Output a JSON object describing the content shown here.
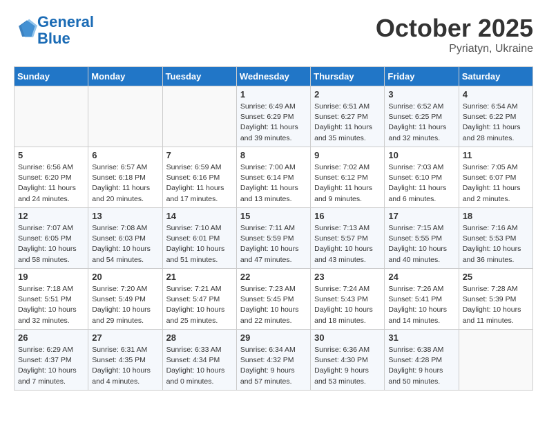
{
  "header": {
    "logo_line1": "General",
    "logo_line2": "Blue",
    "month": "October 2025",
    "location": "Pyriatyn, Ukraine"
  },
  "weekdays": [
    "Sunday",
    "Monday",
    "Tuesday",
    "Wednesday",
    "Thursday",
    "Friday",
    "Saturday"
  ],
  "weeks": [
    [
      {
        "day": "",
        "info": ""
      },
      {
        "day": "",
        "info": ""
      },
      {
        "day": "",
        "info": ""
      },
      {
        "day": "1",
        "info": "Sunrise: 6:49 AM\nSunset: 6:29 PM\nDaylight: 11 hours\nand 39 minutes."
      },
      {
        "day": "2",
        "info": "Sunrise: 6:51 AM\nSunset: 6:27 PM\nDaylight: 11 hours\nand 35 minutes."
      },
      {
        "day": "3",
        "info": "Sunrise: 6:52 AM\nSunset: 6:25 PM\nDaylight: 11 hours\nand 32 minutes."
      },
      {
        "day": "4",
        "info": "Sunrise: 6:54 AM\nSunset: 6:22 PM\nDaylight: 11 hours\nand 28 minutes."
      }
    ],
    [
      {
        "day": "5",
        "info": "Sunrise: 6:56 AM\nSunset: 6:20 PM\nDaylight: 11 hours\nand 24 minutes."
      },
      {
        "day": "6",
        "info": "Sunrise: 6:57 AM\nSunset: 6:18 PM\nDaylight: 11 hours\nand 20 minutes."
      },
      {
        "day": "7",
        "info": "Sunrise: 6:59 AM\nSunset: 6:16 PM\nDaylight: 11 hours\nand 17 minutes."
      },
      {
        "day": "8",
        "info": "Sunrise: 7:00 AM\nSunset: 6:14 PM\nDaylight: 11 hours\nand 13 minutes."
      },
      {
        "day": "9",
        "info": "Sunrise: 7:02 AM\nSunset: 6:12 PM\nDaylight: 11 hours\nand 9 minutes."
      },
      {
        "day": "10",
        "info": "Sunrise: 7:03 AM\nSunset: 6:10 PM\nDaylight: 11 hours\nand 6 minutes."
      },
      {
        "day": "11",
        "info": "Sunrise: 7:05 AM\nSunset: 6:07 PM\nDaylight: 11 hours\nand 2 minutes."
      }
    ],
    [
      {
        "day": "12",
        "info": "Sunrise: 7:07 AM\nSunset: 6:05 PM\nDaylight: 10 hours\nand 58 minutes."
      },
      {
        "day": "13",
        "info": "Sunrise: 7:08 AM\nSunset: 6:03 PM\nDaylight: 10 hours\nand 54 minutes."
      },
      {
        "day": "14",
        "info": "Sunrise: 7:10 AM\nSunset: 6:01 PM\nDaylight: 10 hours\nand 51 minutes."
      },
      {
        "day": "15",
        "info": "Sunrise: 7:11 AM\nSunset: 5:59 PM\nDaylight: 10 hours\nand 47 minutes."
      },
      {
        "day": "16",
        "info": "Sunrise: 7:13 AM\nSunset: 5:57 PM\nDaylight: 10 hours\nand 43 minutes."
      },
      {
        "day": "17",
        "info": "Sunrise: 7:15 AM\nSunset: 5:55 PM\nDaylight: 10 hours\nand 40 minutes."
      },
      {
        "day": "18",
        "info": "Sunrise: 7:16 AM\nSunset: 5:53 PM\nDaylight: 10 hours\nand 36 minutes."
      }
    ],
    [
      {
        "day": "19",
        "info": "Sunrise: 7:18 AM\nSunset: 5:51 PM\nDaylight: 10 hours\nand 32 minutes."
      },
      {
        "day": "20",
        "info": "Sunrise: 7:20 AM\nSunset: 5:49 PM\nDaylight: 10 hours\nand 29 minutes."
      },
      {
        "day": "21",
        "info": "Sunrise: 7:21 AM\nSunset: 5:47 PM\nDaylight: 10 hours\nand 25 minutes."
      },
      {
        "day": "22",
        "info": "Sunrise: 7:23 AM\nSunset: 5:45 PM\nDaylight: 10 hours\nand 22 minutes."
      },
      {
        "day": "23",
        "info": "Sunrise: 7:24 AM\nSunset: 5:43 PM\nDaylight: 10 hours\nand 18 minutes."
      },
      {
        "day": "24",
        "info": "Sunrise: 7:26 AM\nSunset: 5:41 PM\nDaylight: 10 hours\nand 14 minutes."
      },
      {
        "day": "25",
        "info": "Sunrise: 7:28 AM\nSunset: 5:39 PM\nDaylight: 10 hours\nand 11 minutes."
      }
    ],
    [
      {
        "day": "26",
        "info": "Sunrise: 6:29 AM\nSunset: 4:37 PM\nDaylight: 10 hours\nand 7 minutes."
      },
      {
        "day": "27",
        "info": "Sunrise: 6:31 AM\nSunset: 4:35 PM\nDaylight: 10 hours\nand 4 minutes."
      },
      {
        "day": "28",
        "info": "Sunrise: 6:33 AM\nSunset: 4:34 PM\nDaylight: 10 hours\nand 0 minutes."
      },
      {
        "day": "29",
        "info": "Sunrise: 6:34 AM\nSunset: 4:32 PM\nDaylight: 9 hours\nand 57 minutes."
      },
      {
        "day": "30",
        "info": "Sunrise: 6:36 AM\nSunset: 4:30 PM\nDaylight: 9 hours\nand 53 minutes."
      },
      {
        "day": "31",
        "info": "Sunrise: 6:38 AM\nSunset: 4:28 PM\nDaylight: 9 hours\nand 50 minutes."
      },
      {
        "day": "",
        "info": ""
      }
    ]
  ]
}
